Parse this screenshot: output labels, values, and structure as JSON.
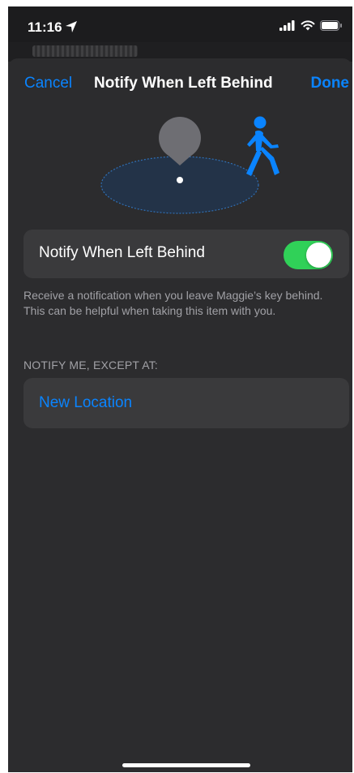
{
  "status_bar": {
    "time": "11:16",
    "icons": [
      "location-arrow-icon",
      "cellular-signal-icon",
      "wifi-icon",
      "battery-icon"
    ]
  },
  "nav": {
    "cancel_label": "Cancel",
    "title": "Notify When Left Behind",
    "done_label": "Done"
  },
  "toggle_row": {
    "label": "Notify When Left Behind",
    "enabled": true
  },
  "description": "Receive a notification when you leave Maggie’s key behind. This can be helpful when taking this item with you.",
  "exceptions": {
    "header": "NOTIFY ME, EXCEPT AT:",
    "add_location_label": "New Location"
  },
  "colors": {
    "accent": "#0a84ff",
    "toggle_on": "#30d158",
    "background": "#2c2c2e",
    "card": "#3a3a3c",
    "secondary_text": "#a1a1a6"
  }
}
